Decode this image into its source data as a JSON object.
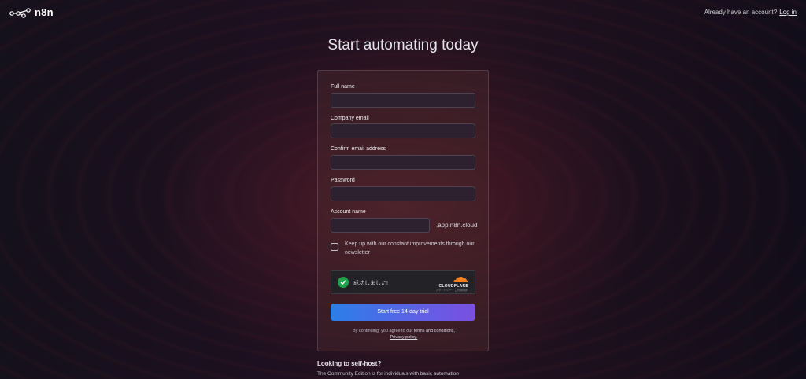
{
  "brand": {
    "name": "n8n"
  },
  "header": {
    "account_question": "Already have an account?",
    "login_link": "Log in"
  },
  "page_title": "Start automating today",
  "form": {
    "full_name": {
      "label": "Full name",
      "value": ""
    },
    "company_email": {
      "label": "Company email",
      "value": ""
    },
    "confirm_email": {
      "label": "Confirm email address",
      "value": ""
    },
    "password": {
      "label": "Password",
      "value": ""
    },
    "account_name": {
      "label": "Account name",
      "value": "",
      "suffix": ".app.n8n.cloud"
    },
    "newsletter": {
      "label": "Keep up with our constant improvements through our newsletter",
      "checked": false
    },
    "turnstile": {
      "status": "成功しました!",
      "provider": "CLOUDFLARE",
      "links": "プライバシー・ご利用規約"
    },
    "submit_label": "Start free 14-day trial",
    "legal_prefix": "By continuing, you agree to our",
    "terms_link": "terms and conditions,",
    "privacy_link": "Privacy policy."
  },
  "self_host": {
    "title": "Looking to self-host?",
    "text": "The Community Edition is for individuals with basic automation"
  },
  "colors": {
    "cta_start": "#2a7fe8",
    "cta_end": "#7a4fe0",
    "success": "#1fa34a",
    "cloudflare": "#f48120"
  }
}
